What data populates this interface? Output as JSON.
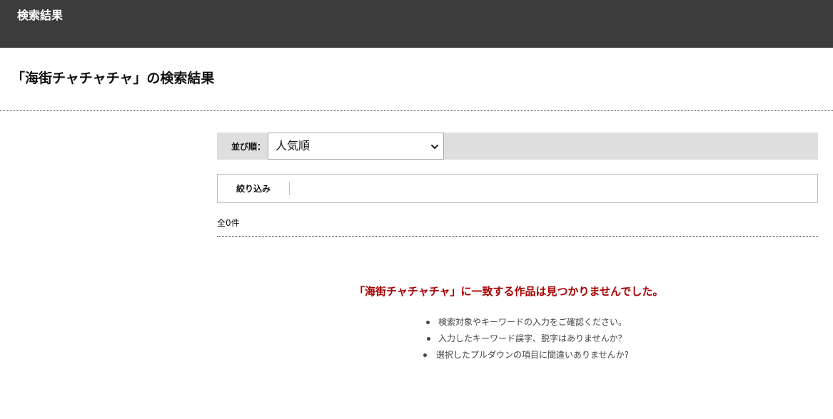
{
  "header": {
    "title": "検索結果"
  },
  "page": {
    "heading": "「海街チャチャチャ」の検索結果"
  },
  "sort": {
    "label": "並び順：",
    "selected": "人気順",
    "icon": "chevron-down-icon"
  },
  "filter": {
    "label": "絞り込み"
  },
  "results": {
    "count_text": "全0件"
  },
  "empty_state": {
    "message": "「海街チャチャチャ」に一致する作品は見つかりませんでした。",
    "color": "#a80000",
    "tips": [
      "検索対象やキーワードの入力をご確認ください。",
      "入力したキーワード誤字、脱字はありませんか？",
      "選択したプルダウンの項目に間違いありませんか?"
    ]
  },
  "colors": {
    "header_bg": "#3c3c3c",
    "sortbar_bg": "#dedede"
  }
}
